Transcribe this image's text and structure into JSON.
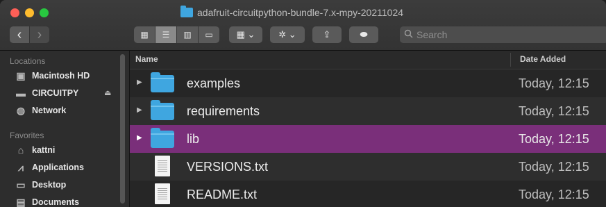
{
  "window": {
    "title": "adafruit-circuitpython-bundle-7.x-mpy-20211024"
  },
  "toolbar": {
    "back": "‹",
    "forward": "›",
    "view_icons": "▦",
    "view_list": "☰",
    "view_columns": "▥",
    "view_gallery": "▭",
    "group_icon": "▦ ⌄",
    "action_icon": "✲ ⌄",
    "share_icon": "⇪",
    "tag_icon": "⬬",
    "search_placeholder": "Search"
  },
  "sidebar": {
    "locations_heading": "Locations",
    "favorites_heading": "Favorites",
    "locations": [
      {
        "label": "Macintosh HD",
        "icon": "hard-drive-icon"
      },
      {
        "label": "CIRCUITPY",
        "icon": "external-drive-icon"
      },
      {
        "label": "Network",
        "icon": "globe-icon"
      }
    ],
    "eject": "⏏",
    "favorites": [
      {
        "label": "kattni",
        "icon": "home-icon"
      },
      {
        "label": "Applications",
        "icon": "applications-icon"
      },
      {
        "label": "Desktop",
        "icon": "desktop-icon"
      },
      {
        "label": "Documents",
        "icon": "documents-icon"
      }
    ]
  },
  "list": {
    "col_name": "Name",
    "col_date": "Date Added",
    "rows": [
      {
        "name": "examples",
        "date": "Today, 12:15",
        "kind": "folder"
      },
      {
        "name": "requirements",
        "date": "Today, 12:15",
        "kind": "folder"
      },
      {
        "name": "lib",
        "date": "Today, 12:15",
        "kind": "folder",
        "selected": true
      },
      {
        "name": "VERSIONS.txt",
        "date": "Today, 12:15",
        "kind": "text"
      },
      {
        "name": "README.txt",
        "date": "Today, 12:15",
        "kind": "text"
      }
    ]
  },
  "colors": {
    "selection": "#7a2f7a",
    "folder": "#3fa6e0"
  }
}
